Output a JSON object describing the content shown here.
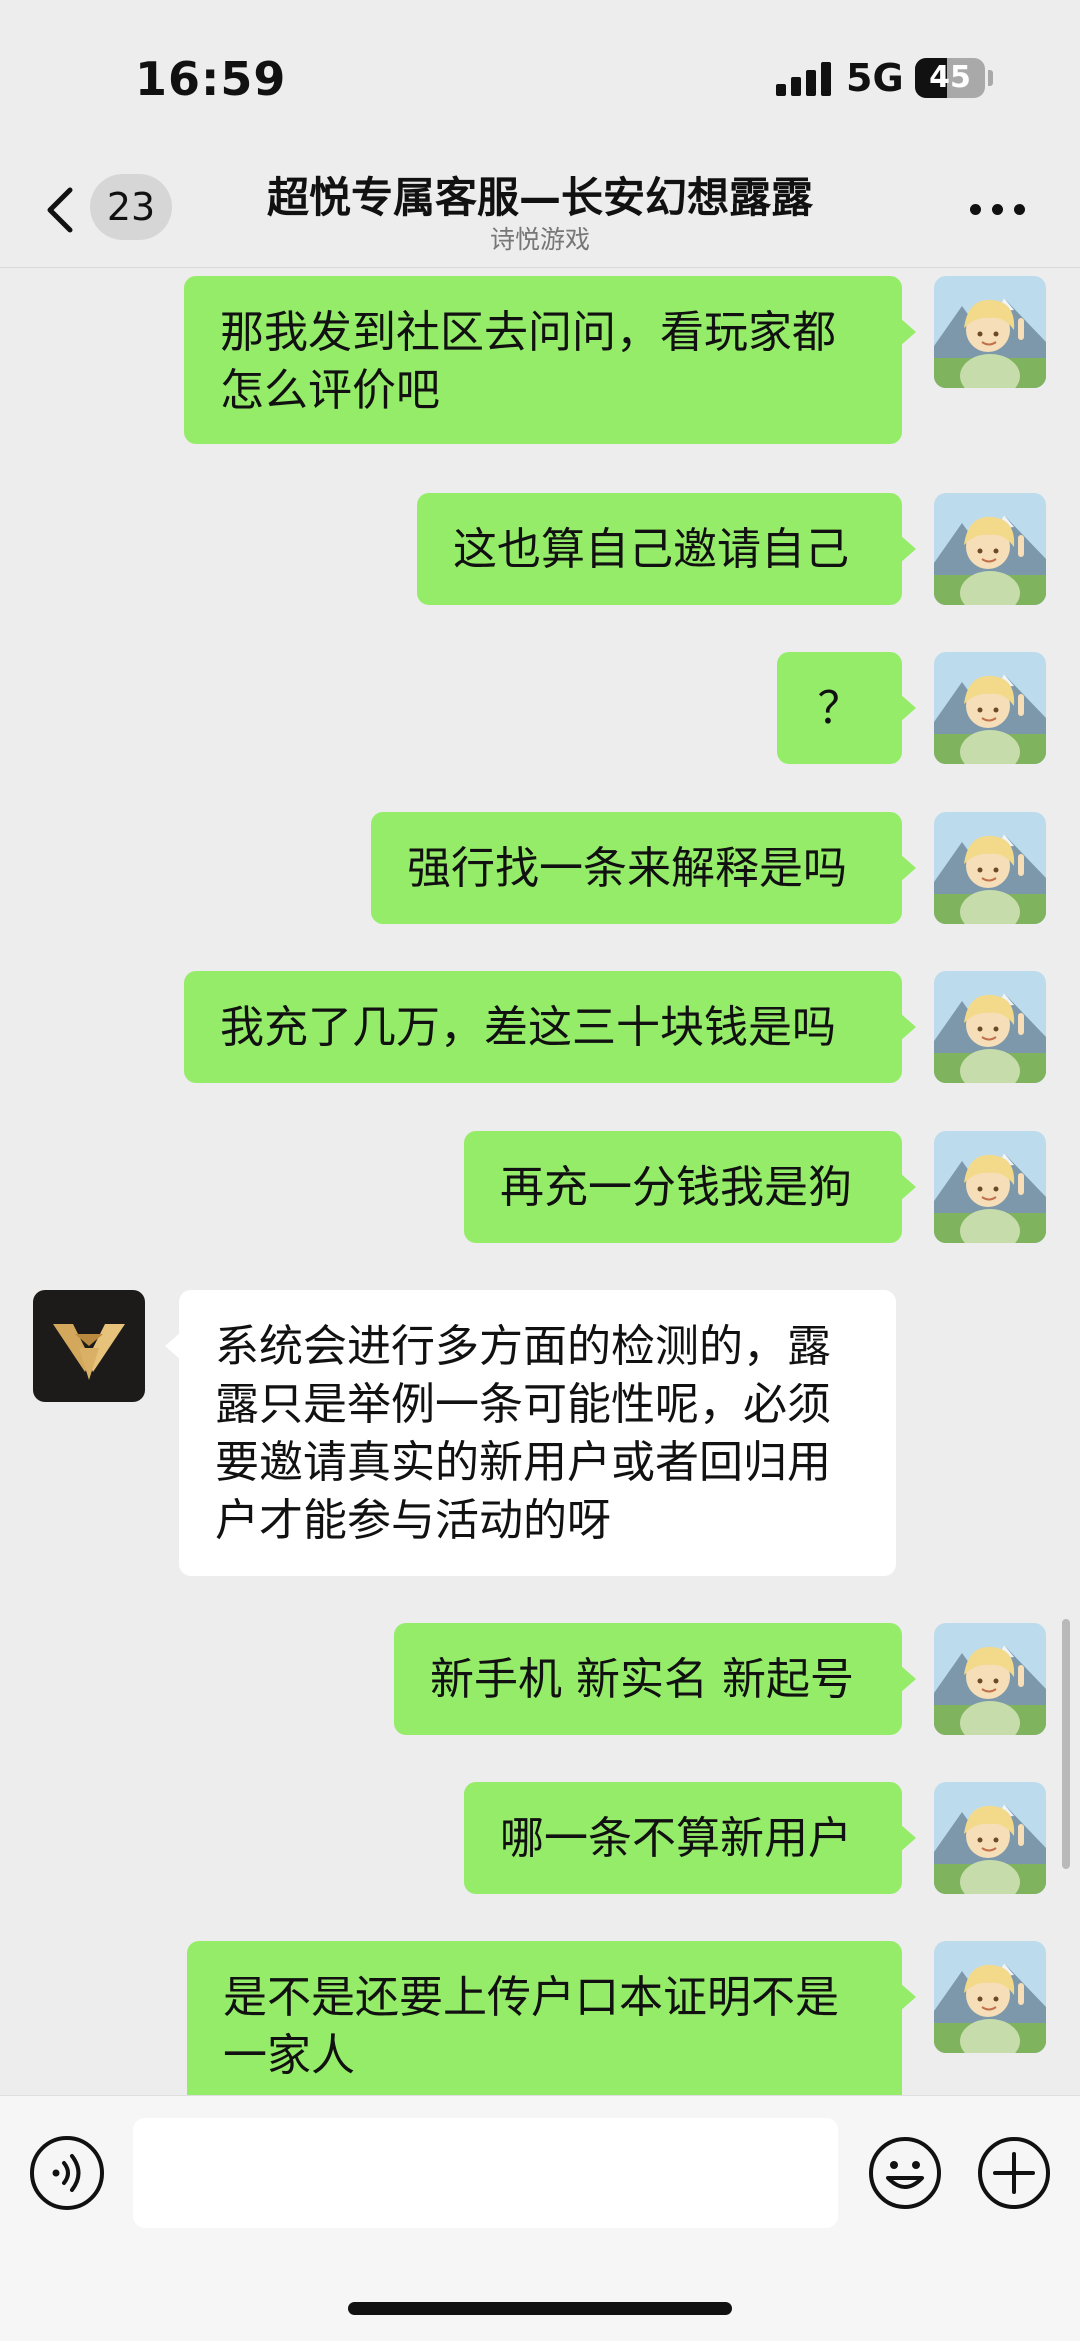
{
  "status_bar": {
    "time": "16:59",
    "network": "5G",
    "battery": "45",
    "battery_level": 0.45
  },
  "nav": {
    "back_icon": "chevron-left-icon",
    "unread_count": "23",
    "title": "超悦专属客服—长安幻想露露",
    "subtitle": "诗悦游戏",
    "more_icon": "more-dots-icon"
  },
  "messages": [
    {
      "side": "sent",
      "text": "那我发到社区去问问，看玩家都怎么评价吧"
    },
    {
      "side": "sent",
      "text": "这也算自己邀请自己"
    },
    {
      "side": "sent",
      "text": "？"
    },
    {
      "side": "sent",
      "text": "强行找一条来解释是吗"
    },
    {
      "side": "sent",
      "text": "我充了几万，差这三十块钱是吗"
    },
    {
      "side": "sent",
      "text": "再充一分钱我是狗"
    },
    {
      "side": "received",
      "text": "系统会进行多方面的检测的，露露只是举例一条可能性呢，必须要邀请真实的新用户或者回归用户才能参与活动的呀"
    },
    {
      "side": "sent",
      "text": "新手机 新实名 新起号"
    },
    {
      "side": "sent",
      "text": "哪一条不算新用户"
    },
    {
      "side": "sent",
      "text": "是不是还要上传户口本证明不是一家人"
    }
  ],
  "input_bar": {
    "voice_icon": "voice-input-icon",
    "placeholder": "",
    "emoji_icon": "emoji-icon",
    "plus_icon": "plus-icon"
  },
  "colors": {
    "background": "#ededed",
    "sent_bubble": "#95ec69",
    "received_bubble": "#ffffff"
  }
}
